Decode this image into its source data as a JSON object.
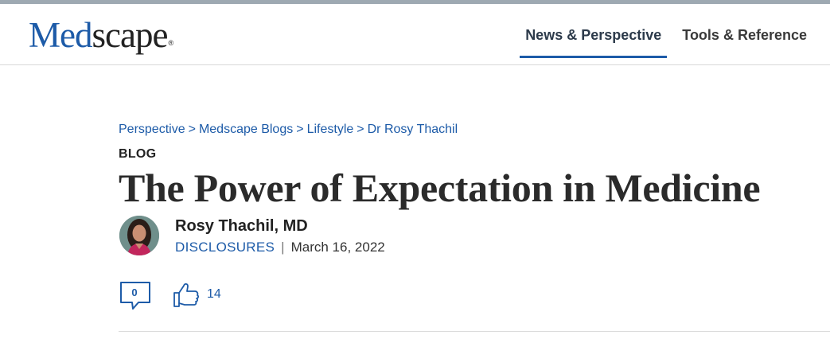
{
  "brand": {
    "logo_part1": "Med",
    "logo_part2": "scape",
    "logo_mark": "®",
    "primary_color": "#1d5ba8"
  },
  "nav": {
    "items": [
      {
        "label": "News & Perspective",
        "active": true
      },
      {
        "label": "Tools & Reference",
        "active": false
      }
    ]
  },
  "breadcrumb": {
    "items": [
      "Perspective",
      "Medscape Blogs",
      "Lifestyle",
      "Dr Rosy Thachil"
    ],
    "separator": ">"
  },
  "article": {
    "kicker": "BLOG",
    "title": "The Power of Expectation in Medicine",
    "author": "Rosy Thachil, MD",
    "disclosures_label": "DISCLOSURES",
    "meta_separator": "|",
    "date": "March 16, 2022"
  },
  "engagement": {
    "comment_count": "0",
    "comment_icon": "speech-bubble-icon",
    "like_icon": "thumbs-up-icon",
    "like_count": "14"
  }
}
